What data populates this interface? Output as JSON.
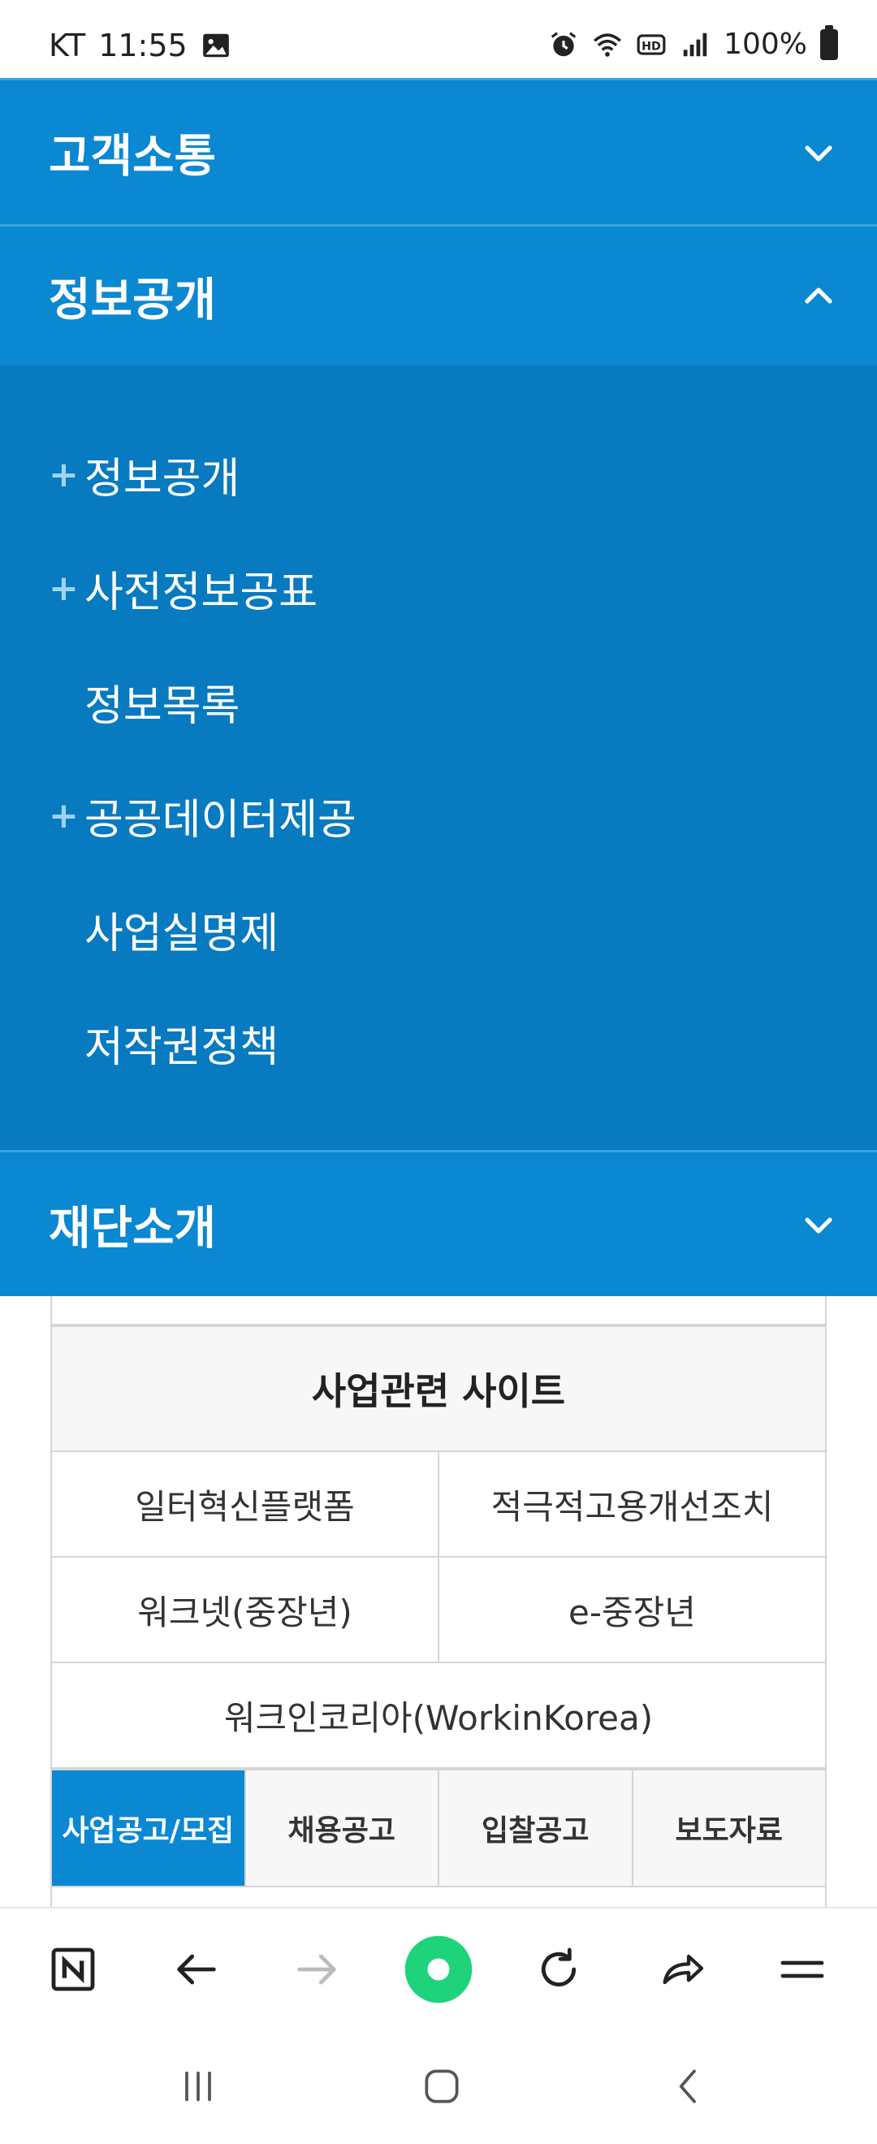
{
  "status_bar": {
    "carrier": "KT",
    "time": "11:55",
    "battery": "100%"
  },
  "accordion": [
    {
      "title": "고객소통",
      "expanded": false
    },
    {
      "title": "정보공개",
      "expanded": true,
      "items": [
        {
          "label": "정보공개",
          "has_children": true
        },
        {
          "label": "사전정보공표",
          "has_children": true
        },
        {
          "label": "정보목록",
          "has_children": false
        },
        {
          "label": "공공데이터제공",
          "has_children": true
        },
        {
          "label": "사업실명제",
          "has_children": false
        },
        {
          "label": "저작권정책",
          "has_children": false
        }
      ]
    },
    {
      "title": "재단소개",
      "expanded": false
    }
  ],
  "related_sites": {
    "title": "사업관련 사이트",
    "rows": [
      [
        "일터혁신플랫폼",
        "적극적고용개선조치"
      ],
      [
        "워크넷(중장년)",
        "e-중장년"
      ],
      [
        "워크인코리아(WorkinKorea)"
      ]
    ]
  },
  "notice_tabs": {
    "active_index": 0,
    "labels": [
      "사업공고/모집",
      "채용공고",
      "입찰공고",
      "보도자료"
    ]
  },
  "colors": {
    "header_blue": "#0a88d2",
    "body_blue": "#077ac0",
    "plus_color": "#9fd3f5",
    "reload_green": "#1ed37a"
  },
  "toolbar_icons": [
    "naver-n-icon",
    "back-arrow-icon",
    "forward-arrow-icon",
    "green-dot-icon",
    "reload-icon",
    "share-icon",
    "menu-icon"
  ],
  "nav_icons": [
    "recent-apps-icon",
    "home-icon",
    "back-icon"
  ]
}
